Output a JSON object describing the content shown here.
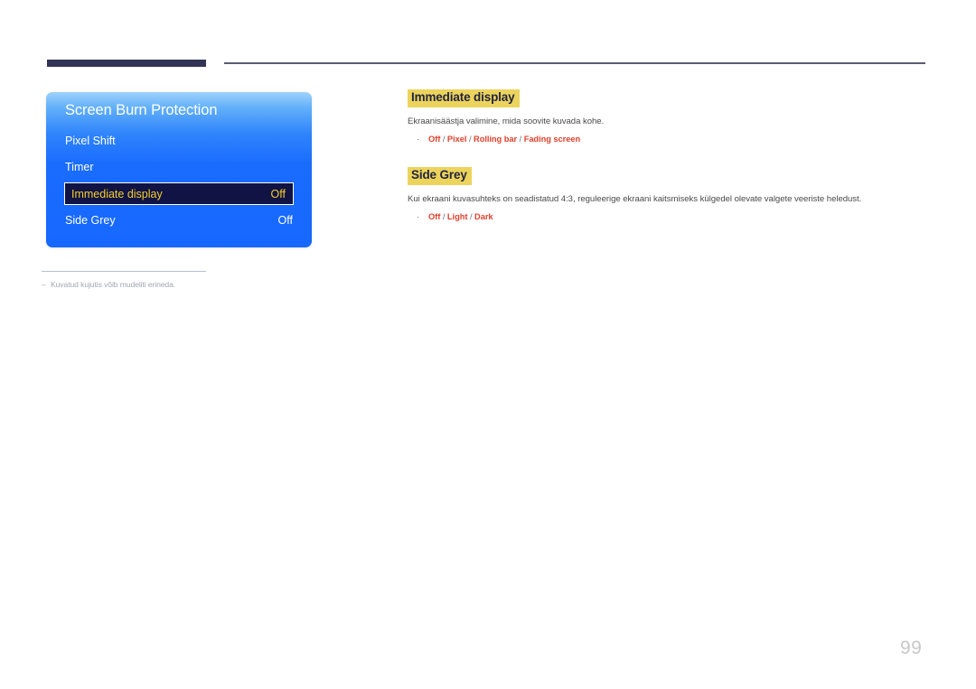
{
  "page": {
    "number": "99"
  },
  "osd": {
    "title": "Screen Burn Protection",
    "rows": [
      {
        "label": "Pixel Shift",
        "value": ""
      },
      {
        "label": "Timer",
        "value": ""
      },
      {
        "label": "Immediate display",
        "value": "Off"
      },
      {
        "label": "Side Grey",
        "value": "Off"
      }
    ]
  },
  "footnote": {
    "dash": "‒",
    "text": "Kuvatud kujutis võib mudeliti erineda."
  },
  "sections": [
    {
      "heading": "Immediate display",
      "description": "Ekraanisäästja valimine, mida soovite kuvada kohe.",
      "options": [
        "Off",
        "Pixel",
        "Rolling bar",
        "Fading screen"
      ],
      "separator": "/",
      "bullet": "·"
    },
    {
      "heading": "Side Grey",
      "description": "Kui ekraani kuvasuhteks on seadistatud 4:3, reguleerige ekraani kaitsmiseks külgedel olevate valgete veeriste heledust.",
      "options": [
        "Off",
        "Light",
        "Dark"
      ],
      "separator": "/",
      "bullet": "·"
    }
  ],
  "colors": {
    "highlight": "#ecd45c",
    "option_red": "#e0402c",
    "osd_blue": "#1668ff",
    "osd_selected_bg": "#101344",
    "osd_selected_text": "#f4cf2a",
    "header_bar": "#333355"
  }
}
